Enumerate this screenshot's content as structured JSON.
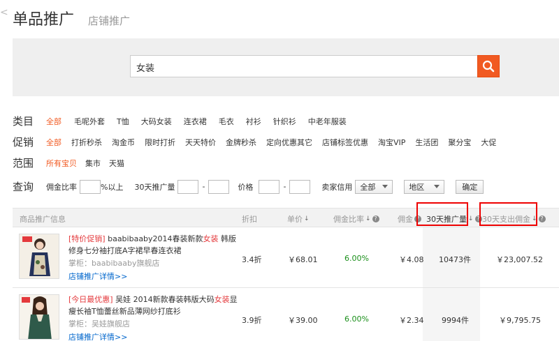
{
  "header": {
    "title": "单品推广",
    "subtab": "店铺推广"
  },
  "search": {
    "value": "女装"
  },
  "filters": {
    "category": {
      "label": "类目",
      "options": [
        "全部",
        "毛呢外套",
        "T恤",
        "大码女装",
        "连衣裙",
        "毛衣",
        "衬衫",
        "针织衫",
        "中老年服装"
      ],
      "active": 0
    },
    "promotion": {
      "label": "促销",
      "options": [
        "全部",
        "打折秒杀",
        "淘金币",
        "限时打折",
        "天天特价",
        "金牌秒杀",
        "定向优惠其它",
        "店铺标签优惠",
        "淘宝VIP",
        "生活团",
        "聚分宝",
        "大促"
      ],
      "active": 0
    },
    "scope": {
      "label": "范围",
      "options": [
        "所有宝贝",
        "集市",
        "天猫"
      ],
      "active": 0
    }
  },
  "query": {
    "label": "查询",
    "commission_label": "佣金比率",
    "commission_suffix": "%以上",
    "sales_label": "30天推广量",
    "dash": "-",
    "price_label": "价格",
    "credit_label": "卖家信用",
    "credit_value": "全部",
    "region_value": "地区",
    "confirm": "确定"
  },
  "table": {
    "headers": {
      "info": "商品推广信息",
      "discount": "折扣",
      "price": "单价",
      "rate": "佣金比率",
      "commission": "佣金",
      "sales30": "30天推广量",
      "spend30": "30天支出佣金"
    },
    "help_glyph": "?",
    "sort_glyph": "↓",
    "rows": [
      {
        "promo": "[特价促销]",
        "title_pre": " baabibaaby2014春装新款",
        "title_hl": "女装",
        "title_post": " 韩版修身七分袖打底A字裙早春连衣裙",
        "shop": "掌柜：baabibaaby旗舰店",
        "link": "店铺推广详情>>",
        "discount": "3.4折",
        "price": "￥68.01",
        "rate": "6.00%",
        "commission": "￥4.08",
        "sales30": "10473件",
        "spend30": "￥23,007.52"
      },
      {
        "promo": "[今日最优惠]",
        "title_pre": " 吴娃 2014新款春装韩版大码",
        "title_hl": "女装",
        "title_post": "显瘦长袖T恤蕾丝新品薄网纱打底衫",
        "shop": "掌柜：吴娃旗舰店",
        "link": "店铺推广详情>>",
        "discount": "3.9折",
        "price": "￥39.00",
        "rate": "6.00%",
        "commission": "￥2.34",
        "sales30": "9994件",
        "spend30": "￥9,795.75"
      }
    ]
  },
  "colors": {
    "accent": "#f15a22",
    "link": "#0066cc",
    "highlight_box": "#ee0000",
    "rate": "#1a8f1a"
  }
}
